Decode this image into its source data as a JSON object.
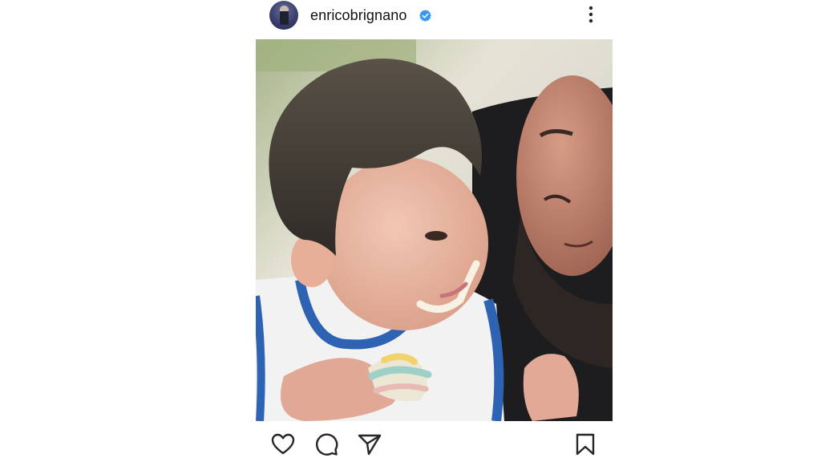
{
  "post": {
    "username": "enricobrignano",
    "verified": true,
    "verified_color": "#3897f0"
  },
  "icons": {
    "avatar": "profile-photo",
    "verified": "verified-badge-icon",
    "more": "more-options-icon",
    "like": "heart-icon",
    "comment": "comment-bubble-icon",
    "share": "paper-plane-icon",
    "save": "bookmark-icon"
  },
  "colors": {
    "text": "#111111",
    "icon": "#262626"
  }
}
